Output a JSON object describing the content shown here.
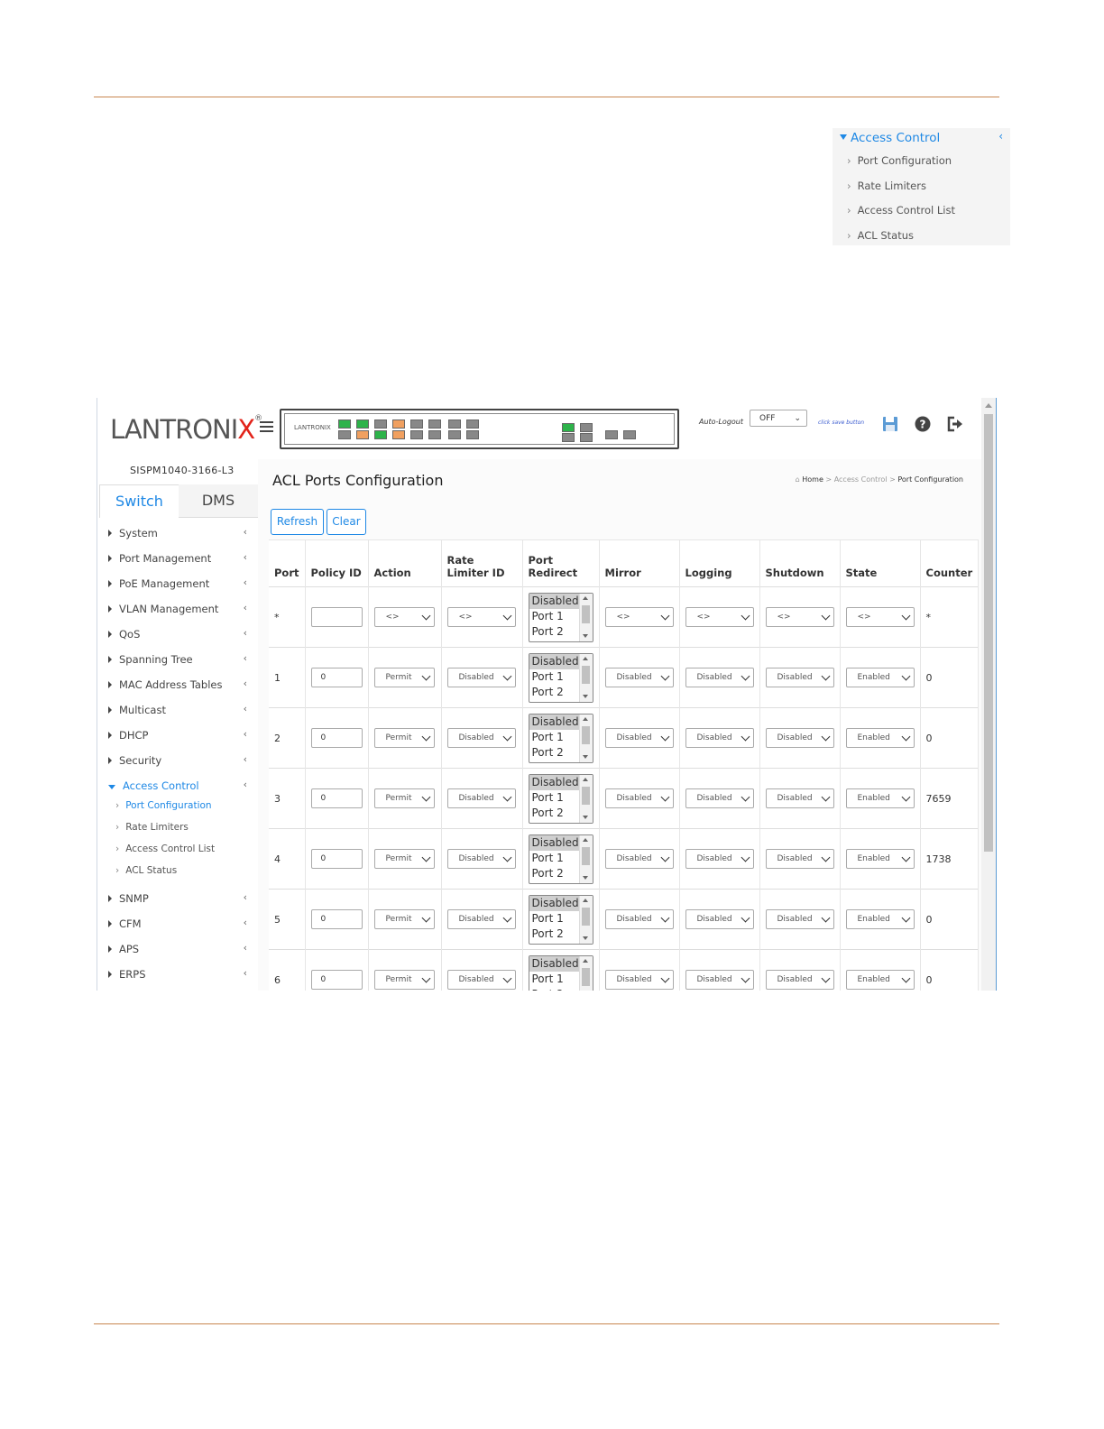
{
  "inset_menu": {
    "title": "Access Control",
    "items": [
      "Port Configuration",
      "Rate Limiters",
      "Access Control List",
      "ACL Status"
    ]
  },
  "header": {
    "logo": "LANTRONIX",
    "auto_logout_label": "Auto-Logout",
    "auto_logout_value": "OFF",
    "save_hint": "click save button"
  },
  "sidebar": {
    "model": "SISPM1040-3166-L3",
    "tab_switch": "Switch",
    "tab_dms": "DMS",
    "items": [
      "System",
      "Port Management",
      "PoE Management",
      "VLAN Management",
      "QoS",
      "Spanning Tree",
      "MAC Address Tables",
      "Multicast",
      "DHCP",
      "Security",
      "Access Control",
      "SNMP",
      "CFM",
      "APS",
      "ERPS"
    ],
    "sub_items": [
      "Port Configuration",
      "Rate Limiters",
      "Access Control List",
      "ACL Status"
    ]
  },
  "page": {
    "title": "ACL Ports Configuration",
    "breadcrumb": [
      "Home",
      "Access Control",
      "Port Configuration"
    ],
    "refresh": "Refresh",
    "clear": "Clear"
  },
  "table": {
    "headers": [
      "Port",
      "Policy ID",
      "Action",
      "Rate Limiter ID",
      "Port Redirect",
      "Mirror",
      "Logging",
      "Shutdown",
      "State",
      "Counter"
    ],
    "redirect_options": [
      "Disabled",
      "Port 1",
      "Port 2"
    ],
    "rows": [
      {
        "port": "*",
        "policy": "",
        "action": "<>",
        "rate": "<>",
        "mirror": "<>",
        "logging": "<>",
        "shutdown": "<>",
        "state": "<>",
        "counter": "*"
      },
      {
        "port": "1",
        "policy": "0",
        "action": "Permit",
        "rate": "Disabled",
        "mirror": "Disabled",
        "logging": "Disabled",
        "shutdown": "Disabled",
        "state": "Enabled",
        "counter": "0"
      },
      {
        "port": "2",
        "policy": "0",
        "action": "Permit",
        "rate": "Disabled",
        "mirror": "Disabled",
        "logging": "Disabled",
        "shutdown": "Disabled",
        "state": "Enabled",
        "counter": "0"
      },
      {
        "port": "3",
        "policy": "0",
        "action": "Permit",
        "rate": "Disabled",
        "mirror": "Disabled",
        "logging": "Disabled",
        "shutdown": "Disabled",
        "state": "Enabled",
        "counter": "7659"
      },
      {
        "port": "4",
        "policy": "0",
        "action": "Permit",
        "rate": "Disabled",
        "mirror": "Disabled",
        "logging": "Disabled",
        "shutdown": "Disabled",
        "state": "Enabled",
        "counter": "1738"
      },
      {
        "port": "5",
        "policy": "0",
        "action": "Permit",
        "rate": "Disabled",
        "mirror": "Disabled",
        "logging": "Disabled",
        "shutdown": "Disabled",
        "state": "Enabled",
        "counter": "0"
      },
      {
        "port": "6",
        "policy": "0",
        "action": "Permit",
        "rate": "Disabled",
        "mirror": "Disabled",
        "logging": "Disabled",
        "shutdown": "Disabled",
        "state": "Enabled",
        "counter": "0"
      }
    ]
  },
  "colors": {
    "accent": "#1e88e5",
    "brand_red": "#e2231a",
    "rule": "#c8864f"
  }
}
